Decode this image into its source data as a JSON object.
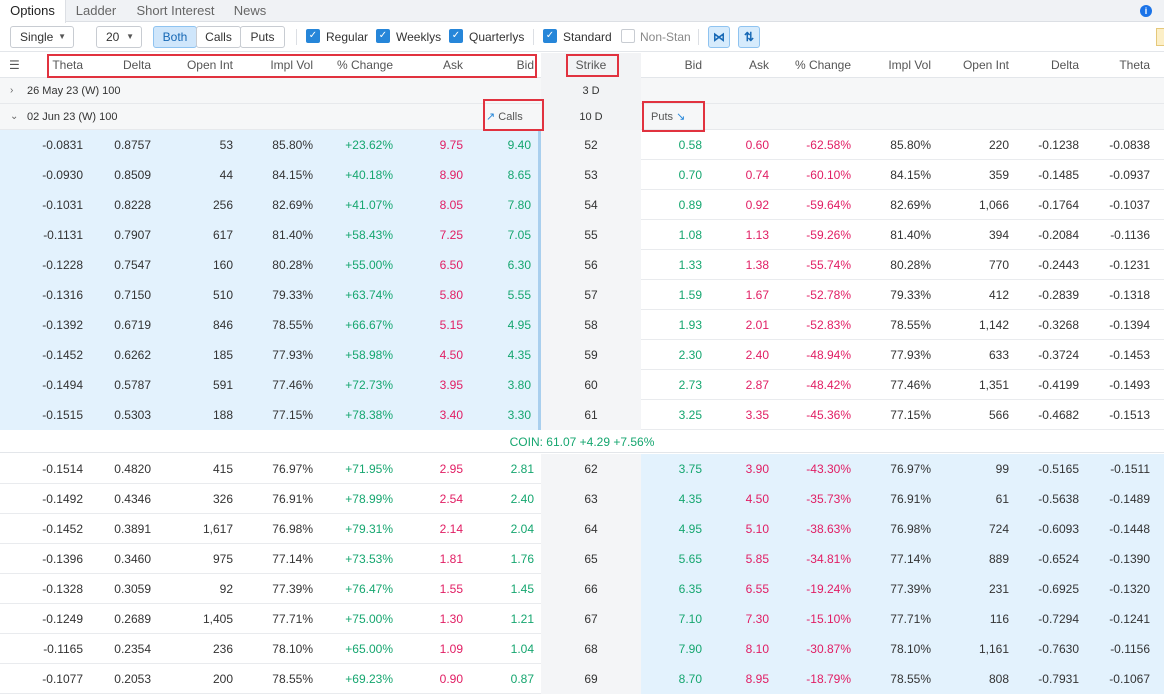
{
  "tabs": [
    "Options",
    "Ladder",
    "Short Interest",
    "News"
  ],
  "toolbar": {
    "strategy": "Single",
    "strikes": "20",
    "segments": [
      "Both",
      "Calls",
      "Puts"
    ],
    "filters": [
      {
        "label": "Regular",
        "checked": true
      },
      {
        "label": "Weeklys",
        "checked": true
      },
      {
        "label": "Quarterlys",
        "checked": true
      },
      {
        "label": "Standard",
        "checked": true
      },
      {
        "label": "Non-Stan",
        "checked": false
      }
    ]
  },
  "columns": {
    "calls": [
      "Theta",
      "Delta",
      "Open Int",
      "Impl Vol",
      "% Change",
      "Ask",
      "Bid"
    ],
    "strike": "Strike",
    "puts": [
      "Bid",
      "Ask",
      "% Change",
      "Impl Vol",
      "Open Int",
      "Delta",
      "Theta"
    ]
  },
  "expirations": [
    {
      "label": "26 May 23 (W) 100",
      "days": "3 D",
      "expanded": false
    },
    {
      "label": "02 Jun 23 (W) 100",
      "days": "10 D",
      "expanded": true
    }
  ],
  "calls_label": "Calls",
  "puts_label": "Puts",
  "underlying": "COIN: 61.07 +4.29 +7.56%",
  "rows": [
    {
      "strike": "52",
      "call": [
        "-0.0831",
        "0.8757",
        "53",
        "85.80%",
        "+23.62%",
        "9.75",
        "9.40"
      ],
      "put": [
        "0.58",
        "0.60",
        "-62.58%",
        "85.80%",
        "220",
        "-0.1238",
        "-0.0838"
      ]
    },
    {
      "strike": "53",
      "call": [
        "-0.0930",
        "0.8509",
        "44",
        "84.15%",
        "+40.18%",
        "8.90",
        "8.65"
      ],
      "put": [
        "0.70",
        "0.74",
        "-60.10%",
        "84.15%",
        "359",
        "-0.1485",
        "-0.0937"
      ]
    },
    {
      "strike": "54",
      "call": [
        "-0.1031",
        "0.8228",
        "256",
        "82.69%",
        "+41.07%",
        "8.05",
        "7.80"
      ],
      "put": [
        "0.89",
        "0.92",
        "-59.64%",
        "82.69%",
        "1,066",
        "-0.1764",
        "-0.1037"
      ]
    },
    {
      "strike": "55",
      "call": [
        "-0.1131",
        "0.7907",
        "617",
        "81.40%",
        "+58.43%",
        "7.25",
        "7.05"
      ],
      "put": [
        "1.08",
        "1.13",
        "-59.26%",
        "81.40%",
        "394",
        "-0.2084",
        "-0.1136"
      ]
    },
    {
      "strike": "56",
      "call": [
        "-0.1228",
        "0.7547",
        "160",
        "80.28%",
        "+55.00%",
        "6.50",
        "6.30"
      ],
      "put": [
        "1.33",
        "1.38",
        "-55.74%",
        "80.28%",
        "770",
        "-0.2443",
        "-0.1231"
      ]
    },
    {
      "strike": "57",
      "call": [
        "-0.1316",
        "0.7150",
        "510",
        "79.33%",
        "+63.74%",
        "5.80",
        "5.55"
      ],
      "put": [
        "1.59",
        "1.67",
        "-52.78%",
        "79.33%",
        "412",
        "-0.2839",
        "-0.1318"
      ]
    },
    {
      "strike": "58",
      "call": [
        "-0.1392",
        "0.6719",
        "846",
        "78.55%",
        "+66.67%",
        "5.15",
        "4.95"
      ],
      "put": [
        "1.93",
        "2.01",
        "-52.83%",
        "78.55%",
        "1,142",
        "-0.3268",
        "-0.1394"
      ]
    },
    {
      "strike": "59",
      "call": [
        "-0.1452",
        "0.6262",
        "185",
        "77.93%",
        "+58.98%",
        "4.50",
        "4.35"
      ],
      "put": [
        "2.30",
        "2.40",
        "-48.94%",
        "77.93%",
        "633",
        "-0.3724",
        "-0.1453"
      ]
    },
    {
      "strike": "60",
      "call": [
        "-0.1494",
        "0.5787",
        "591",
        "77.46%",
        "+72.73%",
        "3.95",
        "3.80"
      ],
      "put": [
        "2.73",
        "2.87",
        "-48.42%",
        "77.46%",
        "1,351",
        "-0.4199",
        "-0.1493"
      ]
    },
    {
      "strike": "61",
      "call": [
        "-0.1515",
        "0.5303",
        "188",
        "77.15%",
        "+78.38%",
        "3.40",
        "3.30"
      ],
      "put": [
        "3.25",
        "3.35",
        "-45.36%",
        "77.15%",
        "566",
        "-0.4682",
        "-0.1513"
      ]
    },
    {
      "strike": "62",
      "call": [
        "-0.1514",
        "0.4820",
        "415",
        "76.97%",
        "+71.95%",
        "2.95",
        "2.81"
      ],
      "put": [
        "3.75",
        "3.90",
        "-43.30%",
        "76.97%",
        "99",
        "-0.5165",
        "-0.1511"
      ]
    },
    {
      "strike": "63",
      "call": [
        "-0.1492",
        "0.4346",
        "326",
        "76.91%",
        "+78.99%",
        "2.54",
        "2.40"
      ],
      "put": [
        "4.35",
        "4.50",
        "-35.73%",
        "76.91%",
        "61",
        "-0.5638",
        "-0.1489"
      ]
    },
    {
      "strike": "64",
      "call": [
        "-0.1452",
        "0.3891",
        "1,617",
        "76.98%",
        "+79.31%",
        "2.14",
        "2.04"
      ],
      "put": [
        "4.95",
        "5.10",
        "-38.63%",
        "76.98%",
        "724",
        "-0.6093",
        "-0.1448"
      ]
    },
    {
      "strike": "65",
      "call": [
        "-0.1396",
        "0.3460",
        "975",
        "77.14%",
        "+73.53%",
        "1.81",
        "1.76"
      ],
      "put": [
        "5.65",
        "5.85",
        "-34.81%",
        "77.14%",
        "889",
        "-0.6524",
        "-0.1390"
      ]
    },
    {
      "strike": "66",
      "call": [
        "-0.1328",
        "0.3059",
        "92",
        "77.39%",
        "+76.47%",
        "1.55",
        "1.45"
      ],
      "put": [
        "6.35",
        "6.55",
        "-19.24%",
        "77.39%",
        "231",
        "-0.6925",
        "-0.1320"
      ]
    },
    {
      "strike": "67",
      "call": [
        "-0.1249",
        "0.2689",
        "1,405",
        "77.71%",
        "+75.00%",
        "1.30",
        "1.21"
      ],
      "put": [
        "7.10",
        "7.30",
        "-15.10%",
        "77.71%",
        "116",
        "-0.7294",
        "-0.1241"
      ]
    },
    {
      "strike": "68",
      "call": [
        "-0.1165",
        "0.2354",
        "236",
        "78.10%",
        "+65.00%",
        "1.09",
        "1.04"
      ],
      "put": [
        "7.90",
        "8.10",
        "-30.87%",
        "78.10%",
        "1,161",
        "-0.7630",
        "-0.1156"
      ]
    },
    {
      "strike": "69",
      "call": [
        "-0.1077",
        "0.2053",
        "200",
        "78.55%",
        "+69.23%",
        "0.90",
        "0.87"
      ],
      "put": [
        "8.70",
        "8.95",
        "-18.79%",
        "78.55%",
        "808",
        "-0.7931",
        "-0.1067"
      ]
    }
  ],
  "colors": {
    "accent": "#2686d9",
    "itm": "#e3f2fd",
    "bid": "#15a66f",
    "ask": "#e11d63",
    "highlight": "#e1323f"
  }
}
